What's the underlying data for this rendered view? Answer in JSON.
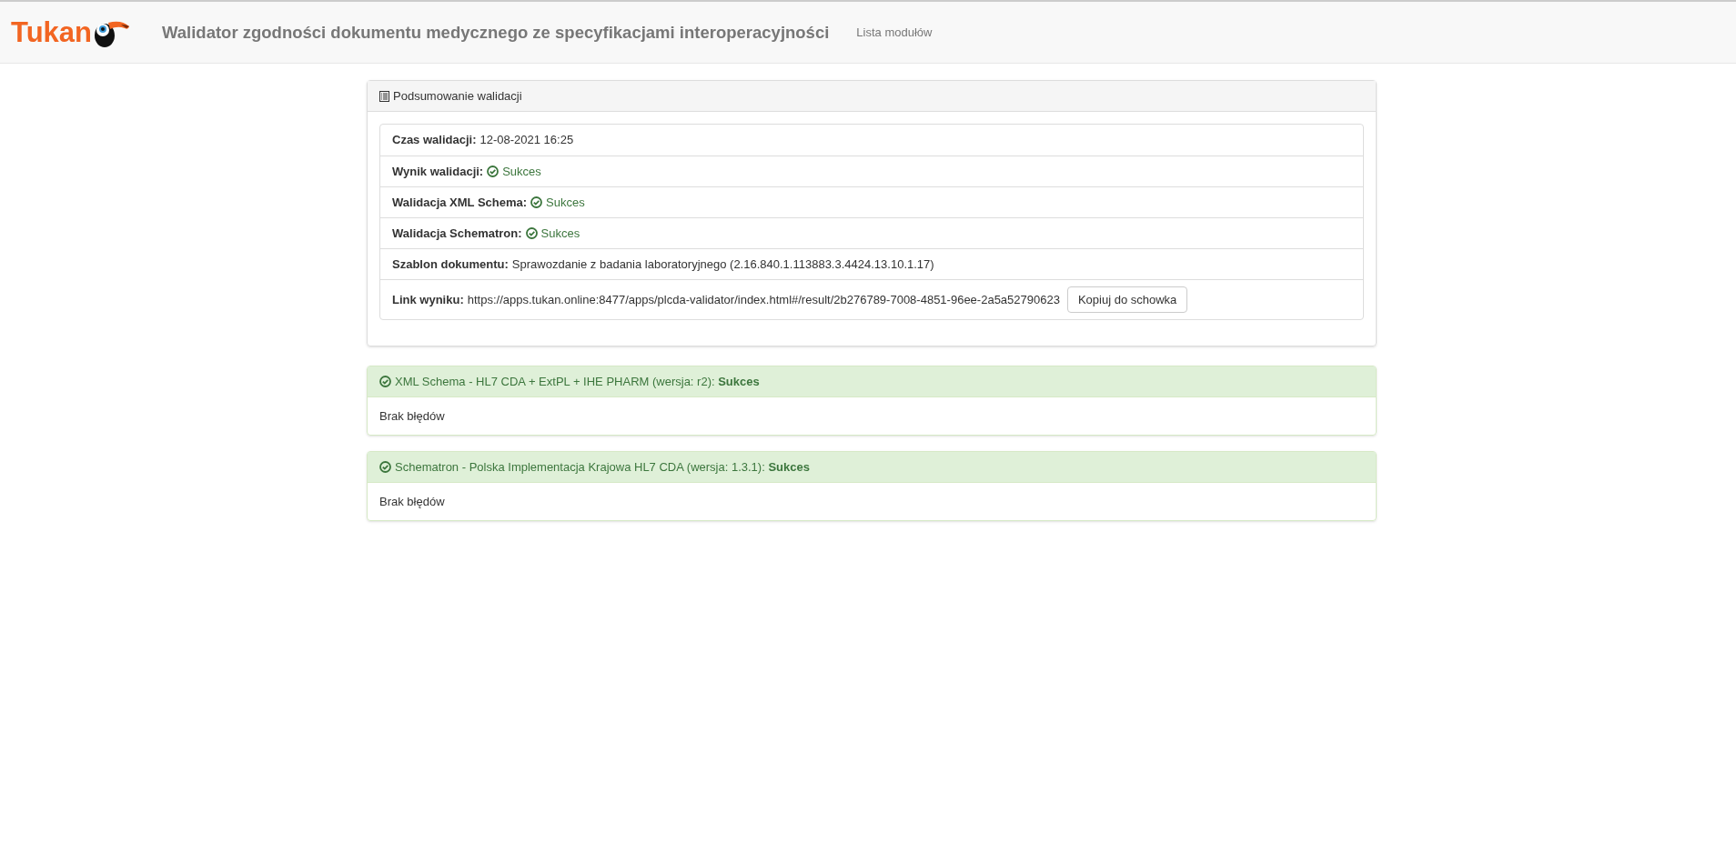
{
  "navbar": {
    "logo": "Tukan",
    "title": "Walidator zgodności dokumentu medycznego ze specyfikacjami interoperacyjności",
    "links": [
      "Lista modułów"
    ]
  },
  "summary": {
    "title": "Podsumowanie walidacji",
    "rows": [
      {
        "kind": "text",
        "label": "Czas walidacji:",
        "value": "12-08-2021 16:25"
      },
      {
        "kind": "status",
        "label": "Wynik walidacji:",
        "value": "Sukces",
        "success": true
      },
      {
        "kind": "status",
        "label": "Walidacja XML Schema:",
        "value": "Sukces",
        "success": true
      },
      {
        "kind": "status",
        "label": "Walidacja Schematron:",
        "value": "Sukces",
        "success": true
      },
      {
        "kind": "text",
        "label": "Szablon dokumentu:",
        "value": "Sprawozdanie z badania laboratoryjnego (2.16.840.1.113883.3.4424.13.10.1.17)"
      },
      {
        "kind": "link",
        "label": "Link wyniku:",
        "value": "https://apps.tukan.online:8477/apps/plcda-validator/index.html#/result/2b276789-7008-4851-96ee-2a5a52790623",
        "button": "Kopiuj do schowka"
      }
    ]
  },
  "results": [
    {
      "title": "XML Schema - HL7 CDA + ExtPL + IHE PHARM (wersja: r2): **Sukces**",
      "success": true,
      "body": "Brak błędów"
    },
    {
      "title": "Schematron - Polska Implementacja Krajowa HL7 CDA (wersja: 1.3.1): **Sukces**",
      "success": true,
      "body": "Brak błędów"
    }
  ]
}
